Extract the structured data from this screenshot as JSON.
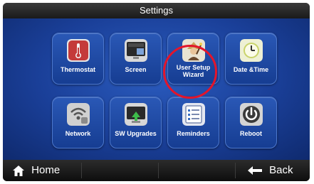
{
  "title": "Settings",
  "tiles": [
    {
      "label": "Thermostat",
      "icon": "thermometer-icon"
    },
    {
      "label": "Screen",
      "icon": "screen-icon"
    },
    {
      "label": "User Setup Wizard",
      "label_line1": "User Setup",
      "label_line2": "Wizard",
      "icon": "wizard-icon",
      "highlighted": true
    },
    {
      "label": "Date &Time",
      "icon": "clock-icon"
    },
    {
      "label": "Network",
      "icon": "network-icon"
    },
    {
      "label": "SW Upgrades",
      "icon": "upgrade-icon"
    },
    {
      "label": "Reminders",
      "icon": "reminders-icon"
    },
    {
      "label": "Reboot",
      "icon": "power-icon"
    }
  ],
  "bottom_bar": {
    "home_label": "Home",
    "back_label": "Back",
    "home_icon": "home-icon",
    "back_icon": "arrow-left-icon"
  },
  "colors": {
    "background": "#1a3f98",
    "tile": "#2a58b6",
    "highlight_ring": "#e3152b"
  }
}
